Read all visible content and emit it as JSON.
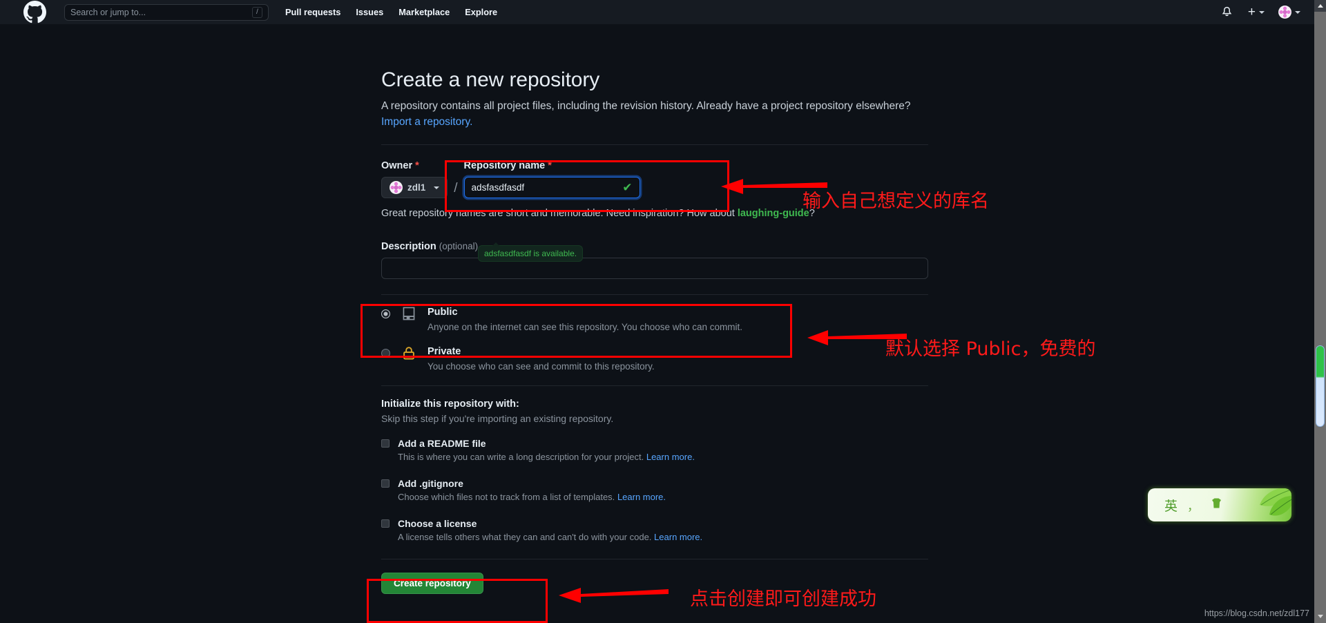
{
  "header": {
    "logo_icon": "github-mark-icon",
    "search": {
      "placeholder": "Search or jump to...",
      "shortcut_key": "/"
    },
    "nav": [
      {
        "label": "Pull requests"
      },
      {
        "label": "Issues"
      },
      {
        "label": "Marketplace"
      },
      {
        "label": "Explore"
      }
    ],
    "right": {
      "notifications_icon": "bell-icon",
      "create_new_icon": "plus-icon",
      "create_new_caret": "chevron-down-icon",
      "avatar_icon": "user-avatar-icon",
      "avatar_caret": "chevron-down-icon"
    }
  },
  "form": {
    "title": "Create a new repository",
    "description_part1": "A repository contains all project files, including the revision history. Already have a project repository elsewhere?",
    "import_link": "Import a repository.",
    "owner_label": "Owner",
    "owner_required": "*",
    "owner_value": "zdl1",
    "owner_caret_icon": "chevron-down-icon",
    "separator": "/",
    "repo_name_label": "Repository name",
    "repo_name_required": "*",
    "repo_name_value": "adsfasdfasdf",
    "repo_name_placeholder": "",
    "repo_valid_icon": "check-icon",
    "availability_tooltip": "adsfasdfasdf is available.",
    "availability_text_before": "Great repository names are short and memorable. Need inspiration? How about ",
    "availability_suggestion": "laughing-guide",
    "availability_text_after": "?",
    "description_label": "Description",
    "description_optional": "(optional)",
    "description_value": "",
    "visibility": [
      {
        "id": "public",
        "icon": "repo-book-icon",
        "title": "Public",
        "desc": "Anyone on the internet can see this repository. You choose who can commit.",
        "selected": true
      },
      {
        "id": "private",
        "icon": "lock-icon",
        "title": "Private",
        "desc": "You choose who can see and commit to this repository.",
        "selected": false
      }
    ],
    "init_title": "Initialize this repository with:",
    "init_sub": "Skip this step if you're importing an existing repository.",
    "init_options": [
      {
        "id": "readme",
        "label": "Add a README file",
        "desc": "This is where you can write a long description for your project.",
        "learn_more": "Learn more.",
        "checked": false
      },
      {
        "id": "gitignore",
        "label": "Add .gitignore",
        "desc": "Choose which files not to track from a list of templates.",
        "learn_more": "Learn more.",
        "checked": false
      },
      {
        "id": "license",
        "label": "Choose a license",
        "desc": "A license tells others what they can and can't do with your code.",
        "learn_more": "Learn more.",
        "checked": false
      }
    ],
    "create_button": "Create repository"
  },
  "annotations": [
    {
      "id": "annotation-repo-name",
      "text": "输入自己想定义的库名"
    },
    {
      "id": "annotation-visibility",
      "text": "默认选择 Public，免费的"
    },
    {
      "id": "annotation-create",
      "text": "点击创建即可创建成功"
    }
  ],
  "ime_widget": {
    "mode_label": "英",
    "punctuation_label": "，",
    "shape_icon": "keyboard-skin-icon"
  },
  "watermark": "https://blog.csdn.net/zdl177",
  "colors": {
    "page_bg": "#0d1117",
    "header_bg": "#161b22",
    "annotation_red": "#ff0000",
    "create_button_green": "#238636",
    "link_blue": "#58a6ff",
    "suggestion_green": "#3fb950"
  }
}
